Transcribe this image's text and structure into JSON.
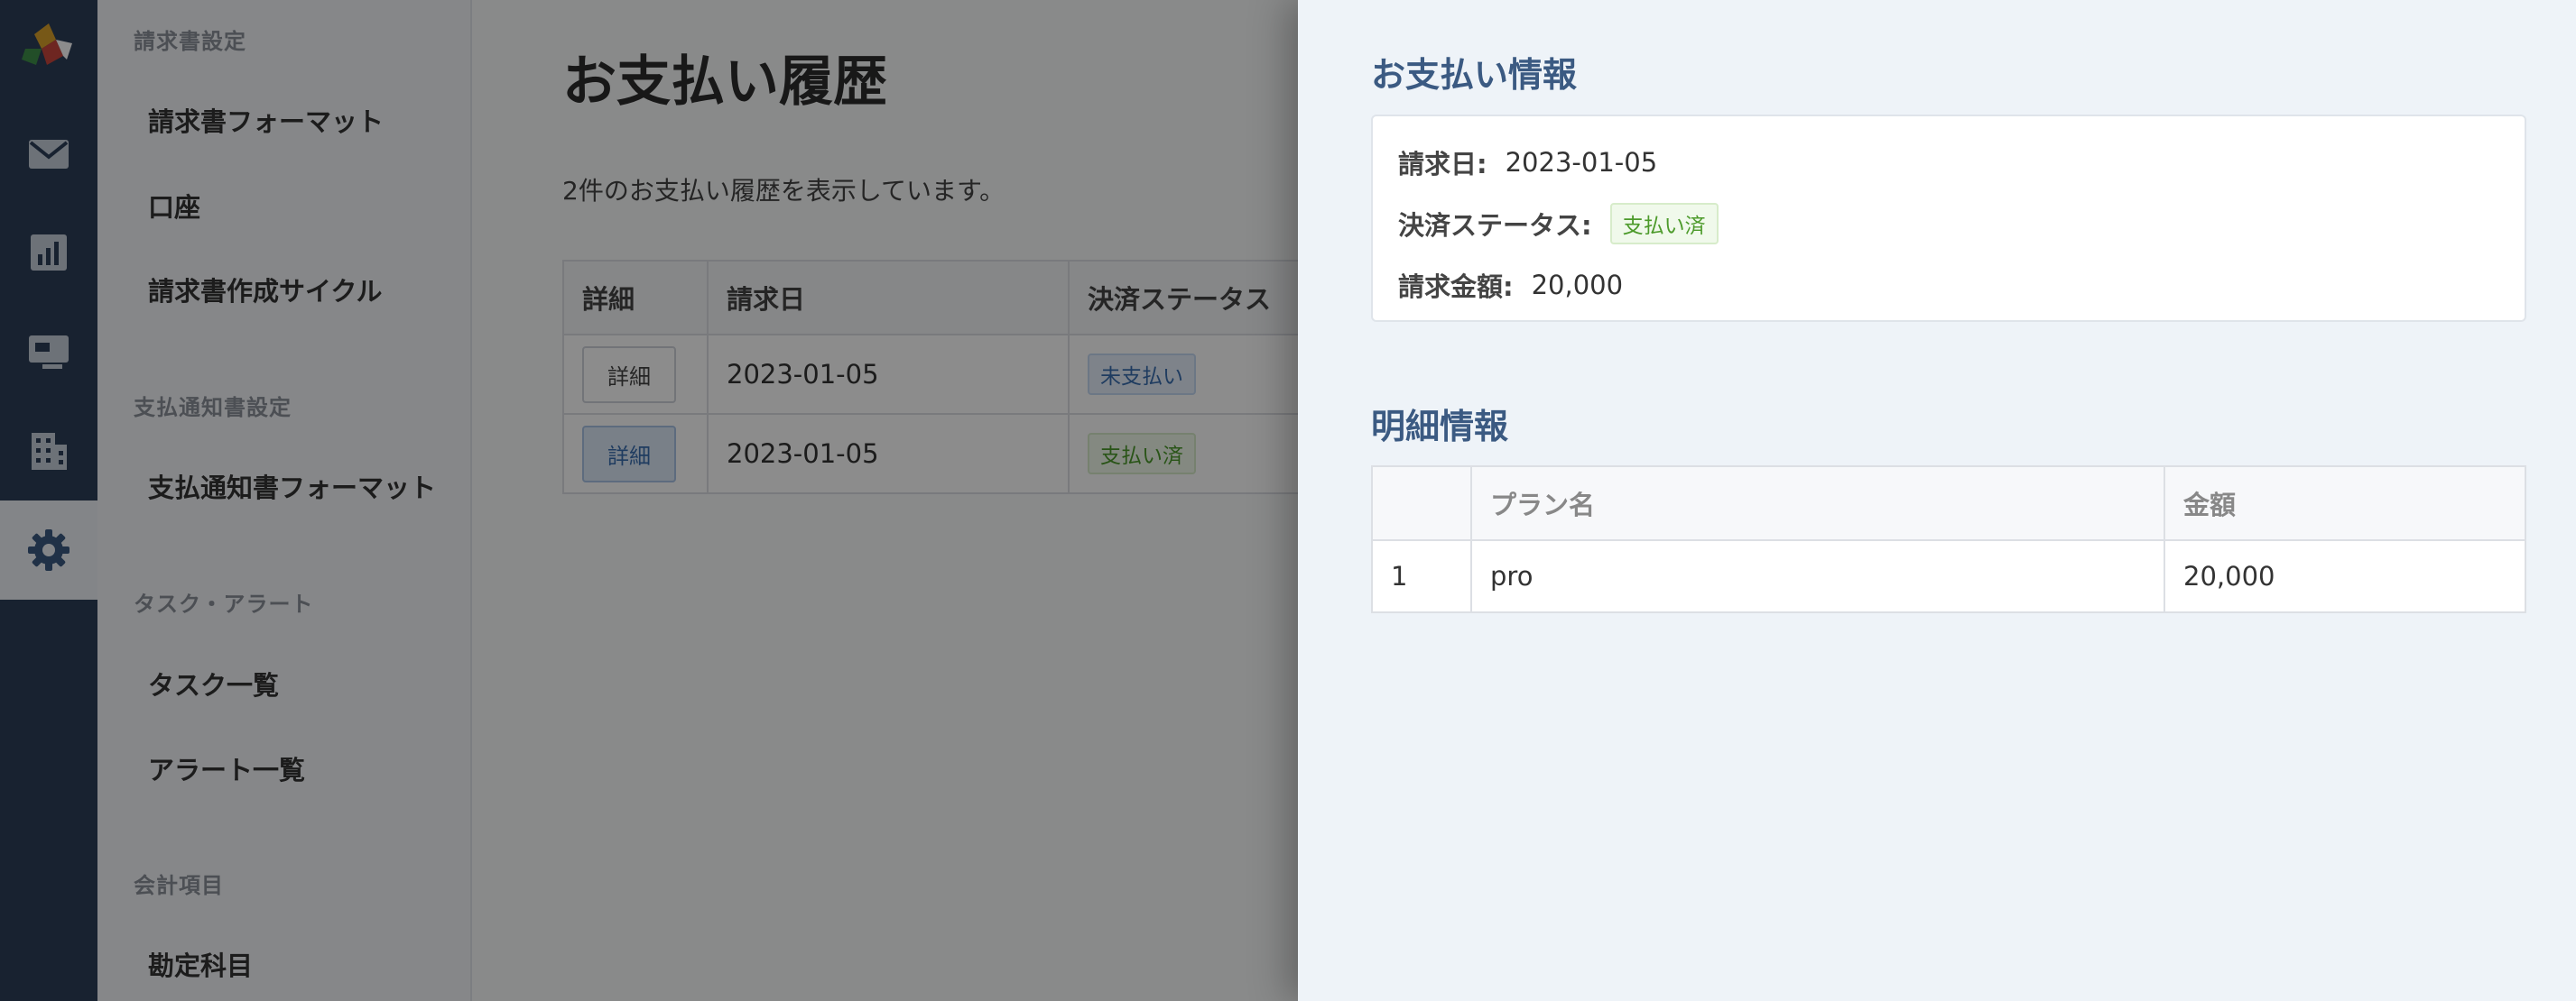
{
  "sidebar": {
    "sections": [
      {
        "title": "請求書設定",
        "items": [
          "請求書フォーマット",
          "口座",
          "請求書作成サイクル"
        ]
      },
      {
        "title": "支払通知書設定",
        "items": [
          "支払通知書フォーマット"
        ]
      },
      {
        "title": "タスク・アラート",
        "items": [
          "タスク一覧",
          "アラート一覧"
        ]
      },
      {
        "title": "会計項目",
        "items": [
          "勘定科目"
        ]
      }
    ]
  },
  "rail": {
    "icons": [
      "logo-icon",
      "mail-icon",
      "chart-icon",
      "monitor-icon",
      "building-icon",
      "gear-icon"
    ],
    "active": "gear-icon"
  },
  "main": {
    "title": "お支払い履歴",
    "count_text": "2件のお支払い履歴を表示しています。",
    "table": {
      "headers": [
        "詳細",
        "請求日",
        "決済ステータス"
      ],
      "rows": [
        {
          "button": "詳細",
          "date": "2023-01-05",
          "status": "未支払い"
        },
        {
          "button": "詳細",
          "date": "2023-01-05",
          "status": "支払い済"
        }
      ]
    }
  },
  "drawer": {
    "payment_heading": "お支払い情報",
    "invoice_date_label": "請求日:",
    "invoice_date": "2023-01-05",
    "status_label": "決済ステータス:",
    "status": "支払い済",
    "amount_label": "請求金額:",
    "amount": "20,000",
    "detail_heading": "明細情報",
    "lines": {
      "headers": [
        "",
        "プラン名",
        "金額"
      ],
      "rows": [
        {
          "no": "1",
          "plan": "pro",
          "amount": "20,000"
        }
      ]
    }
  },
  "colors": {
    "rail": "#2c3e58",
    "accent": "#3b5a82",
    "paid": "#4c9a2a",
    "unpaid": "#3a6db0"
  }
}
